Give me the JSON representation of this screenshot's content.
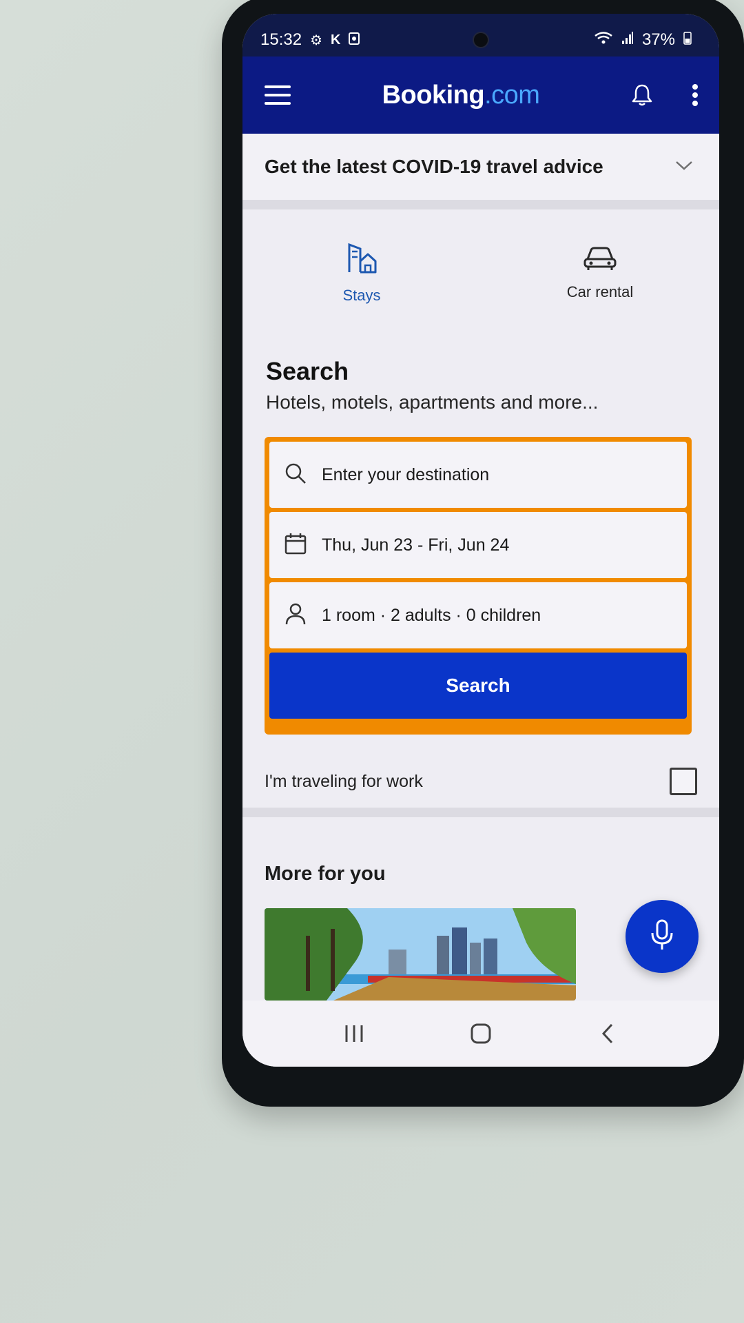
{
  "status_bar": {
    "time": "15:32",
    "battery": "37%",
    "icons": [
      "gear-icon",
      "k-icon",
      "notification-icon",
      "wifi-icon",
      "signal-icon",
      "battery-icon"
    ]
  },
  "app_bar": {
    "brand_main": "Booking",
    "brand_suffix": ".com",
    "actions": [
      "menu-icon",
      "bell-icon",
      "more-vertical-icon"
    ]
  },
  "covid_banner": {
    "text": "Get the latest COVID-19 travel advice"
  },
  "tabs": [
    {
      "label": "Stays",
      "icon": "building-icon",
      "active": true
    },
    {
      "label": "Car rental",
      "icon": "car-icon",
      "active": false
    }
  ],
  "search": {
    "heading": "Search",
    "subheading": "Hotels, motels, apartments and more...",
    "destination_placeholder": "Enter your destination",
    "dates": "Thu, Jun 23 - Fri, Jun 24",
    "guests": "1 room · 2 adults · 0 children",
    "button_label": "Search",
    "work_travel_label": "I'm traveling for work",
    "work_travel_checked": false
  },
  "more_for_you": {
    "heading": "More for you"
  },
  "colors": {
    "brand_blue": "#0c1a84",
    "accent_blue": "#0a35c9",
    "search_border": "#f08a00",
    "link_blue": "#4aa8ff"
  }
}
